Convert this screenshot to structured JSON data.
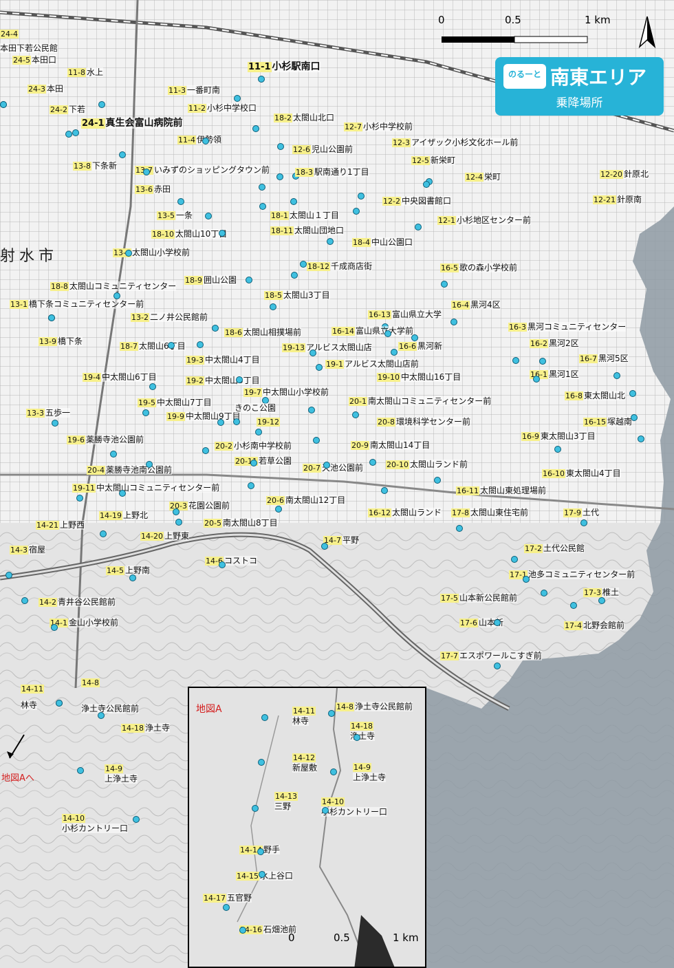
{
  "badge": {
    "logo": "のるーと",
    "area": "南東エリア",
    "subtitle": "乗降場所"
  },
  "city_label": "射水市",
  "scale": {
    "zero": "0",
    "half": "0.5",
    "full": "1 km"
  },
  "inset": {
    "title": "地図A",
    "scale": {
      "zero": "0",
      "half": "0.5",
      "full": "1 km"
    },
    "stops": [
      {
        "code": "14-11",
        "name": "林寺"
      },
      {
        "code": "14-8",
        "name": "浄土寺公民館前"
      },
      {
        "code": "14-18",
        "name": "浄土寺"
      },
      {
        "code": "14-12",
        "name": "新屋敷"
      },
      {
        "code": "14-9",
        "name": "上浄土寺"
      },
      {
        "code": "14-13",
        "name": "三野"
      },
      {
        "code": "14-10",
        "name": "小杉カントリー口"
      },
      {
        "code": "14-14",
        "name": "野手"
      },
      {
        "code": "14-15",
        "name": "水上谷口"
      },
      {
        "code": "14-17",
        "name": "五官野"
      },
      {
        "code": "14-16",
        "name": "石畑池前"
      }
    ]
  },
  "to_map_a": "地図Aへ",
  "stops": [
    {
      "code": "24-4",
      "name": ""
    },
    {
      "code": "",
      "name": "本田下若公民館"
    },
    {
      "code": "24-5",
      "name": "本田口"
    },
    {
      "code": "11-8",
      "name": "水上"
    },
    {
      "code": "11-1",
      "name": "小杉駅南口"
    },
    {
      "code": "24-3",
      "name": "本田"
    },
    {
      "code": "11-3",
      "name": "一番町南"
    },
    {
      "code": "11-2",
      "name": "小杉中学校口"
    },
    {
      "code": "24-2",
      "name": "下若"
    },
    {
      "code": "24-1",
      "name": "真生会富山病院前"
    },
    {
      "code": "18-2",
      "name": "太閤山北口"
    },
    {
      "code": "12-7",
      "name": "小杉中学校前"
    },
    {
      "code": "11-4",
      "name": "伊勢領"
    },
    {
      "code": "12-3",
      "name": "アイザック小杉文化ホール前"
    },
    {
      "code": "12-6",
      "name": "児山公園前"
    },
    {
      "code": "13-8",
      "name": "下条新"
    },
    {
      "code": "12-5",
      "name": "新栄町"
    },
    {
      "code": "13-7",
      "name": "いみずのショッピングタウン前"
    },
    {
      "code": "18-3",
      "name": "駅南通り1丁目"
    },
    {
      "code": "12-4",
      "name": "栄町"
    },
    {
      "code": "12-20",
      "name": "針原北"
    },
    {
      "code": "13-6",
      "name": "赤田"
    },
    {
      "code": "12-2",
      "name": "中央図書館口"
    },
    {
      "code": "12-21",
      "name": "針原南"
    },
    {
      "code": "13-5",
      "name": "一条"
    },
    {
      "code": "18-1",
      "name": "太閤山１丁目"
    },
    {
      "code": "12-1",
      "name": "小杉地区センター前"
    },
    {
      "code": "18-10",
      "name": "太閤山10丁目"
    },
    {
      "code": "18-11",
      "name": "太閤山団地口"
    },
    {
      "code": "18-4",
      "name": "中山公園口"
    },
    {
      "code": "13-4",
      "name": "太閤山小学校前"
    },
    {
      "code": "18-12",
      "name": "千成商店街"
    },
    {
      "code": "16-5",
      "name": "歌の森小学校前"
    },
    {
      "code": "18-9",
      "name": "囲山公園"
    },
    {
      "code": "18-8",
      "name": "太閤山コミュニティセンター"
    },
    {
      "code": "18-5",
      "name": "太閤山3丁目"
    },
    {
      "code": "13-1",
      "name": "橋下条コミュニティセンター前"
    },
    {
      "code": "16-4",
      "name": "黒河4区"
    },
    {
      "code": "16-13",
      "name": "富山県立大学"
    },
    {
      "code": "13-2",
      "name": "二ノ井公民館前"
    },
    {
      "code": "18-6",
      "name": "太閤山相撲場前"
    },
    {
      "code": "16-14",
      "name": "富山県立大学前"
    },
    {
      "code": "16-3",
      "name": "黒河コミュニティセンター"
    },
    {
      "code": "13-9",
      "name": "橋下条"
    },
    {
      "code": "18-7",
      "name": "太閤山6丁目"
    },
    {
      "code": "19-13",
      "name": "アルビス太閤山店"
    },
    {
      "code": "16-6",
      "name": "黒河新"
    },
    {
      "code": "16-2",
      "name": "黒河2区"
    },
    {
      "code": "19-3",
      "name": "中太閤山4丁目"
    },
    {
      "code": "19-1",
      "name": "アルビス太閤山店前"
    },
    {
      "code": "16-7",
      "name": "黒河5区"
    },
    {
      "code": "19-4",
      "name": "中太閤山6丁目"
    },
    {
      "code": "19-10",
      "name": "中太閤山16丁目"
    },
    {
      "code": "16-1",
      "name": "黒河1区"
    },
    {
      "code": "19-2",
      "name": "中太閤山3丁目"
    },
    {
      "code": "19-7",
      "name": "中太閤山小学校前"
    },
    {
      "code": "16-8",
      "name": "東太閤山北"
    },
    {
      "code": "19-5",
      "name": "中太閤山7丁目"
    },
    {
      "code": "20-1",
      "name": "南太閤山コミュニティセンター前"
    },
    {
      "code": "13-3",
      "name": "五歩一"
    },
    {
      "code": "19-9",
      "name": "中太閤山9丁目"
    },
    {
      "code": "",
      "name": "きのこ公園"
    },
    {
      "code": "19-12",
      "name": ""
    },
    {
      "code": "20-8",
      "name": "環境科学センター前"
    },
    {
      "code": "16-15",
      "name": "塚越南"
    },
    {
      "code": "19-6",
      "name": "薬勝寺池公園前"
    },
    {
      "code": "20-2",
      "name": "小杉南中学校前"
    },
    {
      "code": "20-9",
      "name": "南太閤山14丁目"
    },
    {
      "code": "16-9",
      "name": "東太閤山3丁目"
    },
    {
      "code": "20-4",
      "name": "薬勝寺池南公園前"
    },
    {
      "code": "20-11",
      "name": "若草公園"
    },
    {
      "code": "20-7",
      "name": "天池公園前"
    },
    {
      "code": "20-10",
      "name": "太閤山ランド前"
    },
    {
      "code": "16-10",
      "name": "東太閤山4丁目"
    },
    {
      "code": "19-11",
      "name": "中太閤山コミュニティセンター前"
    },
    {
      "code": "16-11",
      "name": "太閤山東処理場前"
    },
    {
      "code": "20-3",
      "name": "花園公園前"
    },
    {
      "code": "20-6",
      "name": "南太閤山12丁目"
    },
    {
      "code": "14-19",
      "name": "上野北"
    },
    {
      "code": "14-21",
      "name": "上野西"
    },
    {
      "code": "16-12",
      "name": "太閤山ランド"
    },
    {
      "code": "17-8",
      "name": "太閤山東住宅前"
    },
    {
      "code": "17-9",
      "name": "土代"
    },
    {
      "code": "20-5",
      "name": "南太閤山8丁目"
    },
    {
      "code": "14-20",
      "name": "上野東"
    },
    {
      "code": "14-7",
      "name": "平野"
    },
    {
      "code": "14-3",
      "name": "宿屋"
    },
    {
      "code": "17-2",
      "name": "土代公民館"
    },
    {
      "code": "14-6",
      "name": "コストコ"
    },
    {
      "code": "14-5",
      "name": "上野南"
    },
    {
      "code": "17-1",
      "name": "池多コミュニティセンター前"
    },
    {
      "code": "14-2",
      "name": "青井谷公民館前"
    },
    {
      "code": "17-3",
      "name": "椎土"
    },
    {
      "code": "17-5",
      "name": "山本新公民館前"
    },
    {
      "code": "14-1",
      "name": "金山小学校前"
    },
    {
      "code": "17-6",
      "name": "山本新"
    },
    {
      "code": "17-4",
      "name": "北野会館前"
    },
    {
      "code": "17-7",
      "name": "エスポワールこすぎ前"
    },
    {
      "code": "14-8",
      "name": ""
    },
    {
      "code": "14-11",
      "name": ""
    },
    {
      "code": "",
      "name": "浄土寺公民館前"
    },
    {
      "code": "",
      "name": "林寺"
    },
    {
      "code": "14-18",
      "name": "浄土寺"
    },
    {
      "code": "14-9",
      "name": "上浄土寺"
    },
    {
      "code": "14-10",
      "name": "小杉カントリー口"
    }
  ]
}
